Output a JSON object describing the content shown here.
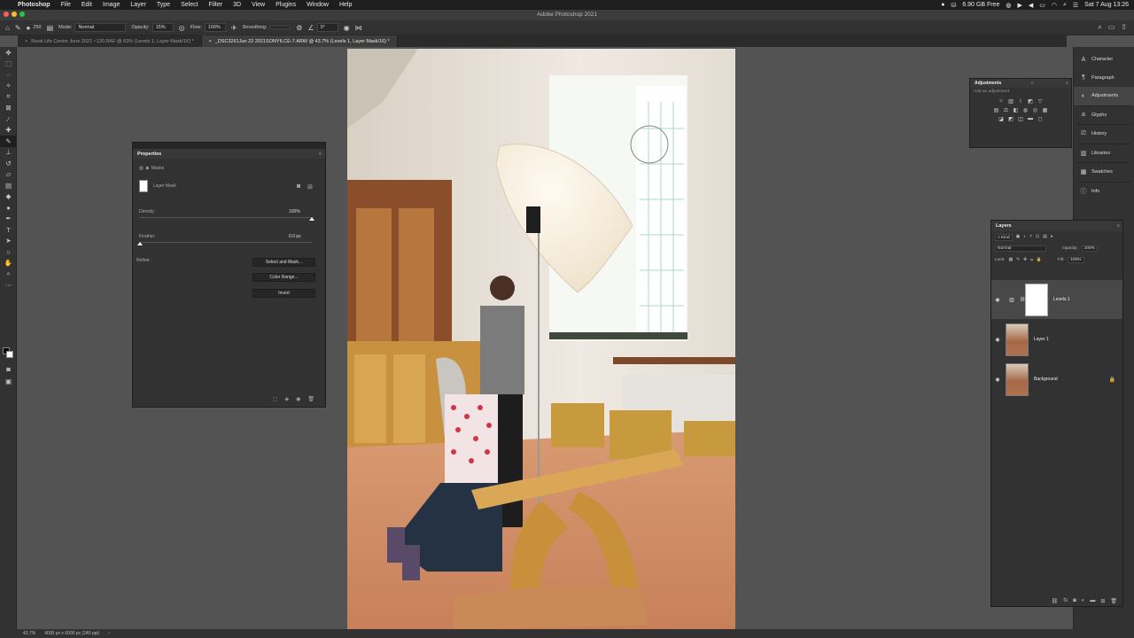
{
  "menubar": {
    "app_name": "Photoshop",
    "items": [
      "File",
      "Edit",
      "Image",
      "Layer",
      "Type",
      "Select",
      "Filter",
      "3D",
      "View",
      "Plugins",
      "Window",
      "Help"
    ],
    "disk_free": "6.90 GB Free",
    "datetime": "Sat 7 Aug 13:26"
  },
  "window": {
    "title": "Adobe Photoshop 2021"
  },
  "options_bar": {
    "brush_size": "250",
    "mode_label": "Mode:",
    "mode_value": "Normal",
    "opacity_label": "Opacity:",
    "opacity_value": "15%",
    "flow_label": "Flow:",
    "flow_value": "100%",
    "smoothing_label": "Smoothing:",
    "angle_value": "0°"
  },
  "tabs": [
    {
      "label": "Rural Life Centre June 2021 ~130.RAF @ 63% (Levels 1, Layer Mask/16) *",
      "active": false
    },
    {
      "label": "_DSC3261Jun 22 2021SONYILCE-7.ARW @ 43.7% (Levels 1, Layer Mask/16) *",
      "active": true
    }
  ],
  "properties": {
    "title": "Properties",
    "section": "Masks",
    "mask_label": "Layer Mask",
    "density_label": "Density:",
    "density_value": "100%",
    "feather_label": "Feather:",
    "feather_value": "0.0 px",
    "refine_label": "Refine:",
    "buttons": [
      "Select and Mask...",
      "Color Range...",
      "Invert"
    ]
  },
  "adjustments": {
    "title": "Adjustments",
    "hint": "Add an adjustment"
  },
  "dock": {
    "items": [
      {
        "label": "Character",
        "icon": "A"
      },
      {
        "label": "Paragraph",
        "icon": "¶"
      },
      {
        "label": "Adjustments",
        "icon": "◐"
      },
      {
        "label": "Glyphs",
        "icon": "a"
      },
      {
        "label": "History",
        "icon": "⎚"
      },
      {
        "label": "Libraries",
        "icon": "▥"
      },
      {
        "label": "Swatches",
        "icon": "▦"
      },
      {
        "label": "Info",
        "icon": "ⓘ"
      }
    ],
    "active": "Adjustments"
  },
  "layers": {
    "title": "Layers",
    "filter_kind": "Kind",
    "blend_mode": "Normal",
    "opacity_label": "Opacity:",
    "opacity_value": "100%",
    "lock_label": "Lock:",
    "fill_label": "Fill:",
    "fill_value": "100%",
    "items": [
      {
        "name": "Levels 1",
        "type": "adjustment",
        "active": true
      },
      {
        "name": "Layer 1",
        "type": "pixel",
        "active": false
      },
      {
        "name": "Background",
        "type": "pixel",
        "locked": true,
        "active": false
      }
    ]
  },
  "status": {
    "zoom": "43.7%",
    "doc_info": "4000 px x 6000 px (240 ppi)"
  },
  "colors": {
    "panel_bg": "#323232",
    "canvas_bg": "#535353",
    "accent": "#31a8ff"
  }
}
